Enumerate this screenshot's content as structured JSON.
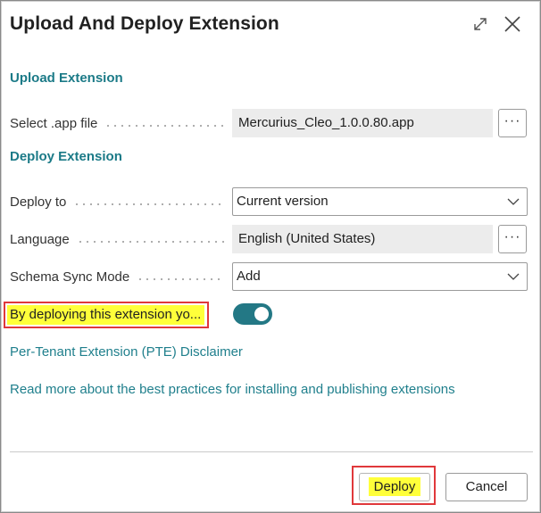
{
  "dialog": {
    "title": "Upload And Deploy Extension"
  },
  "upload_section": {
    "header": "Upload Extension",
    "select_file": {
      "label": "Select .app file",
      "value": "Mercurius_Cleo_1.0.0.80.app",
      "button": "···"
    }
  },
  "deploy_section": {
    "header": "Deploy Extension",
    "deploy_to": {
      "label": "Deploy to",
      "value": "Current version"
    },
    "language": {
      "label": "Language",
      "value": "English (United States)",
      "button": "···"
    },
    "schema_sync_mode": {
      "label": "Schema Sync Mode",
      "value": "Add"
    },
    "consent": {
      "label": "By deploying this extension yo...",
      "toggle_on": true
    }
  },
  "links": {
    "disclaimer": "Per-Tenant Extension (PTE) Disclaimer",
    "read_more": "Read more about the best practices for installing and publishing extensions"
  },
  "footer": {
    "deploy_label": "Deploy",
    "cancel_label": "Cancel"
  },
  "colors": {
    "accent": "#1b7a87",
    "toggle": "#237885",
    "highlight": "#ffff3a",
    "annotation": "#e0383b"
  },
  "icons": [
    "expand-icon",
    "close-icon",
    "chevron-down-icon"
  ]
}
